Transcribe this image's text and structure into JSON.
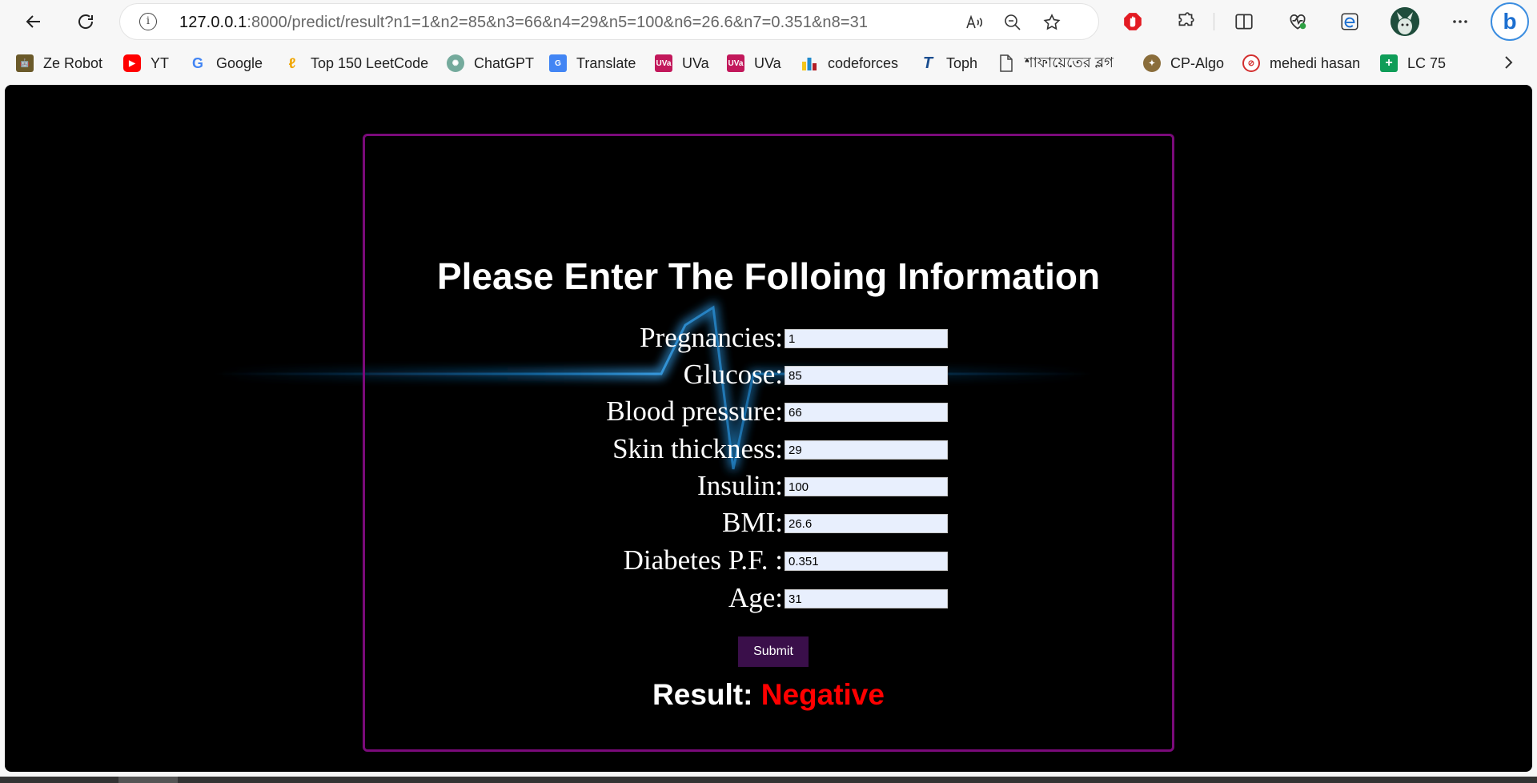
{
  "browser": {
    "url_host": "127.0.0.1",
    "url_rest": ":8000/predict/result?n1=1&n2=85&n3=66&n4=29&n5=100&n6=26.6&n7=0.351&n8=31",
    "info_glyph": "i"
  },
  "bookmarks": [
    {
      "label": "Ze Robot",
      "icon": "robot-icon",
      "color": "#6b5a2a"
    },
    {
      "label": "YT",
      "icon": "youtube-icon",
      "color": "#ff0000"
    },
    {
      "label": "Google",
      "icon": "google-icon",
      "color": "#4285f4"
    },
    {
      "label": "Top 150 LeetCode",
      "icon": "leetcode-icon",
      "color": "#f0a500"
    },
    {
      "label": "ChatGPT",
      "icon": "chatgpt-icon",
      "color": "#74aa9c"
    },
    {
      "label": "Translate",
      "icon": "translate-icon",
      "color": "#4285f4"
    },
    {
      "label": "UVa",
      "icon": "uva-icon",
      "color": "#c2185b"
    },
    {
      "label": "UVa",
      "icon": "uva-icon",
      "color": "#c2185b"
    },
    {
      "label": "codeforces",
      "icon": "codeforces-icon",
      "color": "#1f8acb"
    },
    {
      "label": "Toph",
      "icon": "toph-icon",
      "color": "#1a4d8f"
    },
    {
      "label": "শাফায়েতের ব্লগ",
      "icon": "document-icon",
      "color": "#555555"
    },
    {
      "label": "CP-Algo",
      "icon": "cp-algo-icon",
      "color": "#8a6d3b"
    },
    {
      "label": "mehedi hasan",
      "icon": "profile-icon",
      "color": "#d32f2f"
    },
    {
      "label": "LC 75",
      "icon": "lc75-icon",
      "color": "#0f9d58"
    }
  ],
  "page": {
    "title": "Please Enter The Folloing Information",
    "fields": [
      {
        "label": "Pregnancies:",
        "value": "1"
      },
      {
        "label": "Glucose:",
        "value": "85"
      },
      {
        "label": "Blood pressure:",
        "value": "66"
      },
      {
        "label": "Skin thickness:",
        "value": "29"
      },
      {
        "label": "Insulin:",
        "value": "100"
      },
      {
        "label": "BMI:",
        "value": "26.6"
      },
      {
        "label": "Diabetes P.F. :",
        "value": "0.351"
      },
      {
        "label": "Age:",
        "value": "31"
      }
    ],
    "submit_label": "Submit",
    "result_label": "Result:",
    "result_value": "Negative",
    "colors": {
      "card_border": "#7a0a7a",
      "submit_bg": "#3a0f4a",
      "result_value": "#ff0000",
      "input_bg": "#e8effd"
    }
  }
}
